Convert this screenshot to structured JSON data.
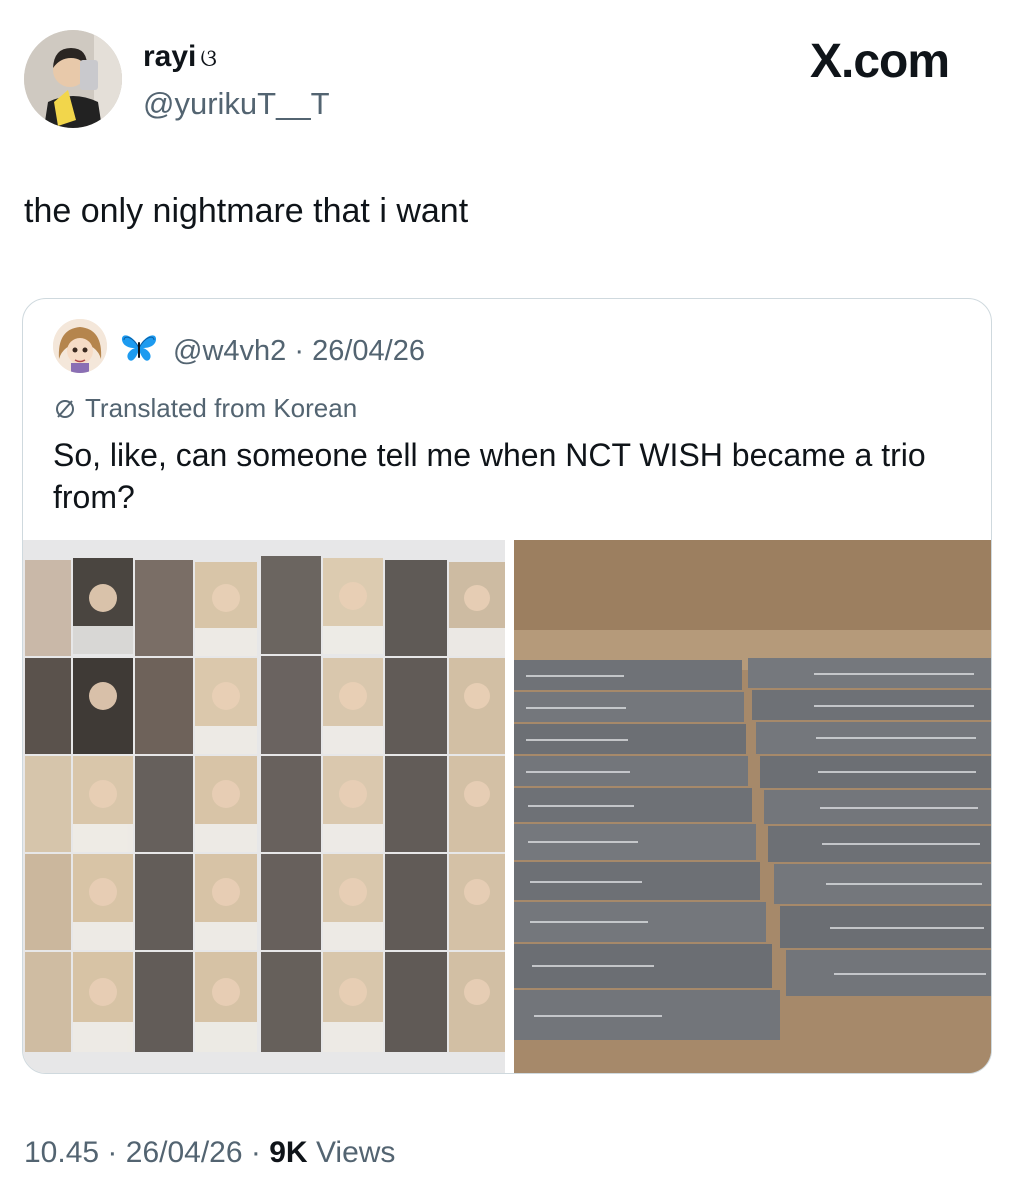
{
  "author": {
    "display_name": "rayi",
    "display_name_emoji": "ଓ",
    "handle": "@yurikuT__T"
  },
  "brand": "X.com",
  "tweet_text": "the only nightmare that i want",
  "quote": {
    "handle": "@w4vh2",
    "separator": "·",
    "date": "26/04/26",
    "translated_label": "Translated from Korean",
    "text": "So, like, can someone tell me when NCT WISH became a trio from?",
    "images": [
      "photocards-grid-photo",
      "album-boxes-photo"
    ]
  },
  "footer": {
    "time": "10.45",
    "sep1": "·",
    "date": "26/04/26",
    "sep2": "·",
    "views_count": "9K",
    "views_label": "Views"
  },
  "colors": {
    "text": "#0f1419",
    "secondary": "#536471",
    "border": "#cfd9de",
    "butterfly": "#1d9bf0"
  }
}
